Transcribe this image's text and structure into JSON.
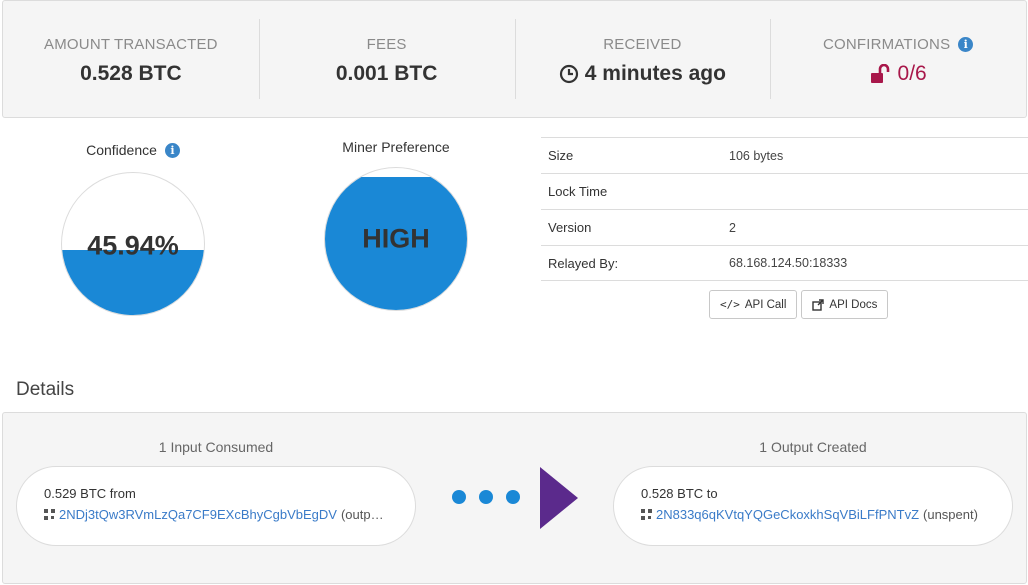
{
  "summary": {
    "amount": {
      "label": "AMOUNT TRANSACTED",
      "value": "0.528 BTC"
    },
    "fees": {
      "label": "FEES",
      "value": "0.001 BTC"
    },
    "received": {
      "label": "RECEIVED",
      "value": "4 minutes ago",
      "icon": "clock-icon"
    },
    "confirmations": {
      "label": "CONFIRMATIONS",
      "value": "0/6",
      "icon": "unlock-icon",
      "color": "#a8174a"
    }
  },
  "confidence": {
    "title": "Confidence",
    "value": "45.94%",
    "fill_fraction": 0.4594,
    "color": "#1a88d6"
  },
  "miner_preference": {
    "title": "Miner Preference",
    "value": "HIGH",
    "fill_fraction": 0.94,
    "color": "#1a88d6"
  },
  "properties": [
    {
      "key": "Size",
      "value": "106 bytes"
    },
    {
      "key": "Lock Time",
      "value": ""
    },
    {
      "key": "Version",
      "value": "2"
    },
    {
      "key": "Relayed By:",
      "value": "68.168.124.50:18333"
    }
  ],
  "buttons": {
    "api_call": "API Call",
    "api_docs": "API Docs"
  },
  "details": {
    "title": "Details",
    "inputs_heading": "1 Input Consumed",
    "outputs_heading": "1 Output Created",
    "input": {
      "amount": "0.529 BTC",
      "from_word": "from",
      "address": "2NDj3tQw3RVmLzQa7CF9EXcBhyCgbVbEgDV",
      "suffix": "(outp…"
    },
    "output": {
      "amount": "0.528 BTC",
      "to_word": "to",
      "address": "2N833q6qKVtqYQGeCkoxkhSqVBiLFfPNTvZ",
      "suffix": "(unspent)"
    }
  }
}
